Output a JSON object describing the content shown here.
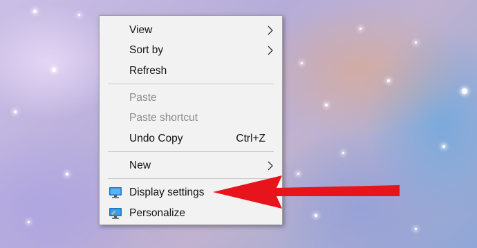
{
  "context_menu": {
    "items": [
      {
        "label": "View",
        "has_submenu": true
      },
      {
        "label": "Sort by",
        "has_submenu": true
      },
      {
        "label": "Refresh"
      },
      {
        "label": "Paste",
        "disabled": true
      },
      {
        "label": "Paste shortcut",
        "disabled": true
      },
      {
        "label": "Undo Copy",
        "shortcut": "Ctrl+Z"
      },
      {
        "label": "New",
        "has_submenu": true
      },
      {
        "label": "Display settings",
        "icon": "display-settings-icon"
      },
      {
        "label": "Personalize",
        "icon": "personalize-icon"
      }
    ]
  },
  "annotation": {
    "arrow_color": "#e8141b",
    "points_to": "Display settings"
  },
  "colors": {
    "menu_background": "#f2f2f2",
    "separator": "#c8c8c8",
    "disabled_text": "#8a8a8a"
  }
}
